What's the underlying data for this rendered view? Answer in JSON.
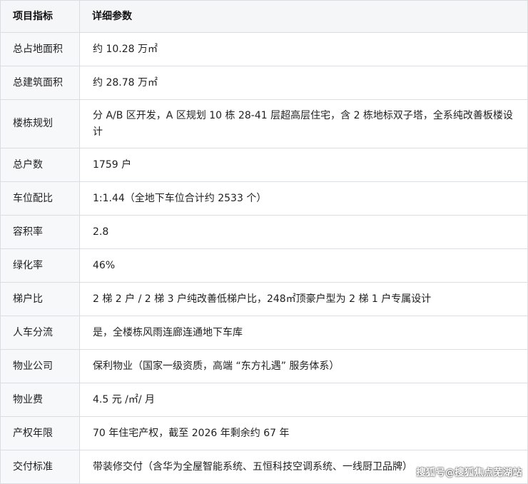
{
  "table": {
    "headers": [
      "项目指标",
      "详细参数"
    ],
    "rows": [
      {
        "key": "总占地面积",
        "value": "约 10.28 万㎡"
      },
      {
        "key": "总建筑面积",
        "value": "约 28.78 万㎡"
      },
      {
        "key": "楼栋规划",
        "value": "分 A/B 区开发，A 区规划 10 栋 28-41 层超高层住宅，含 2 栋地标双子塔，全系纯改善板楼设计"
      },
      {
        "key": "总户数",
        "value": "1759 户"
      },
      {
        "key": "车位配比",
        "value": "1:1.44（全地下车位合计约 2533 个）"
      },
      {
        "key": "容积率",
        "value": "2.8"
      },
      {
        "key": "绿化率",
        "value": "46%"
      },
      {
        "key": "梯户比",
        "value": "2 梯 2 户 / 2 梯 3 户纯改善低梯户比，248㎡顶豪户型为 2 梯 1 户专属设计"
      },
      {
        "key": "人车分流",
        "value": "是，全楼栋风雨连廊连通地下车库"
      },
      {
        "key": "物业公司",
        "value": "保利物业（国家一级资质，高端 “东方礼遇” 服务体系）"
      },
      {
        "key": "物业费",
        "value": "4.5 元 /㎡/ 月"
      },
      {
        "key": "产权年限",
        "value": "70 年住宅产权，截至 2026 年剩余约 67 年"
      },
      {
        "key": "交付标准",
        "value": "带装修交付（含华为全屋智能系统、五恒科技空调系统、一线厨卫品牌）"
      }
    ]
  },
  "watermark": "搜狐号@搜狐焦点芜湖站"
}
